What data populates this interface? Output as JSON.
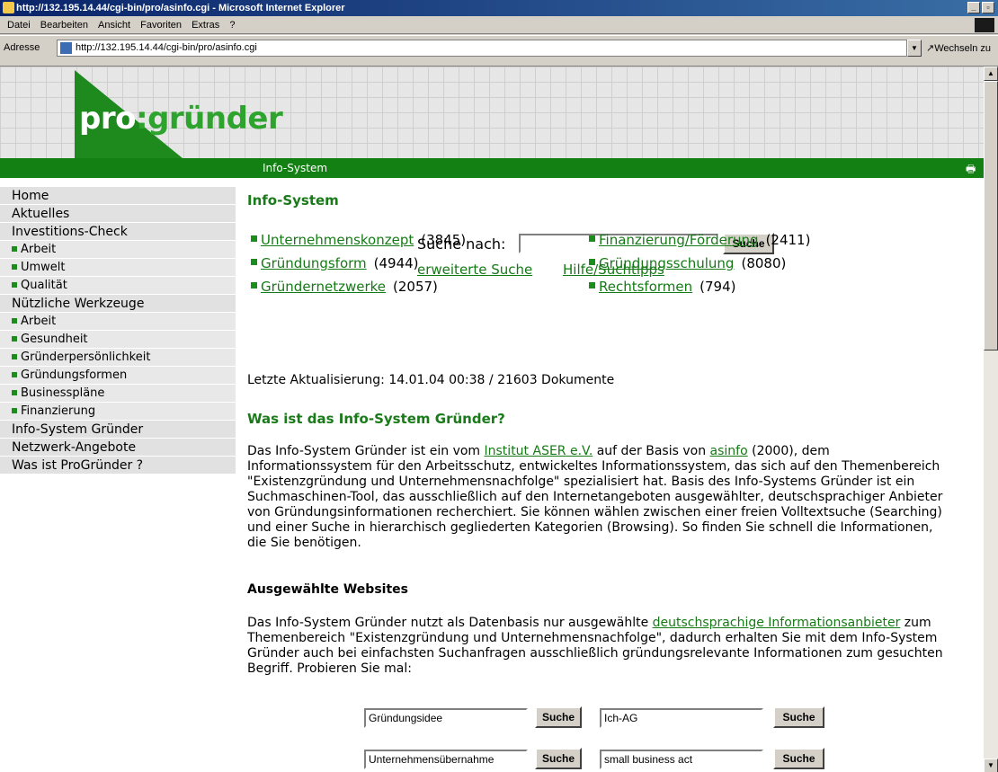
{
  "window": {
    "title": "http://132.195.14.44/cgi-bin/pro/asinfo.cgi - Microsoft Internet Explorer",
    "controls": [
      "_",
      "▫",
      "x"
    ]
  },
  "menu": [
    "Datei",
    "Bearbeiten",
    "Ansicht",
    "Favoriten",
    "Extras",
    "?"
  ],
  "address": {
    "label": "Adresse",
    "url": "http://132.195.14.44/cgi-bin/pro/asinfo.cgi",
    "go": "Wechseln zu"
  },
  "header": {
    "logo_part1": "pro",
    "logo_part2": ":gründer",
    "bar_title": "Info-System"
  },
  "sidebar": [
    {
      "label": "Home",
      "sub": false
    },
    {
      "label": "Aktuelles",
      "sub": false
    },
    {
      "label": "Investitions-Check",
      "sub": false
    },
    {
      "label": "Arbeit",
      "sub": true
    },
    {
      "label": "Umwelt",
      "sub": true
    },
    {
      "label": "Qualität",
      "sub": true
    },
    {
      "label": "Nützliche Werkzeuge",
      "sub": false
    },
    {
      "label": "Arbeit",
      "sub": true
    },
    {
      "label": "Gesundheit",
      "sub": true
    },
    {
      "label": "Gründerpersönlichkeit",
      "sub": true
    },
    {
      "label": "Gründungsformen",
      "sub": true
    },
    {
      "label": "Businesspläne",
      "sub": true
    },
    {
      "label": "Finanzierung",
      "sub": true
    },
    {
      "label": "Info-System Gründer",
      "sub": false
    },
    {
      "label": "Netzwerk-Angebote",
      "sub": false
    },
    {
      "label": "Was ist ProGründer ?",
      "sub": false
    }
  ],
  "main": {
    "title": "Info-System",
    "search_label": "Suche nach:",
    "search_value": "",
    "search_button": "Suche",
    "link_advanced": "erweiterte Suche",
    "link_help": "Hilfe/Suchtipps",
    "categories": [
      {
        "label": "Unternehmenskonzept",
        "count": "(3845)"
      },
      {
        "label": "Finanzierung/Förderung",
        "count": "(2411)"
      },
      {
        "label": "Gründungsform",
        "count": "(4944)"
      },
      {
        "label": "Gründungsschulung",
        "count": "(8080)"
      },
      {
        "label": "Gründernetzwerke",
        "count": "(2057)"
      },
      {
        "label": "Rechtsformen",
        "count": "(794)"
      }
    ],
    "updated": "Letzte Aktualisierung: 14.01.04 00:38 / 21603 Dokumente",
    "heading2": "Was ist das Info-System Gründer?",
    "para1": {
      "pre": "Das Info-System Gründer ist ein vom ",
      "link1": "Institut ASER e.V.",
      "mid": " auf der Basis von ",
      "link2": "asinfo",
      "post": " (2000), dem Informationssystem für den Arbeitsschutz, entwickeltes Informationssystem, das sich auf den Themenbereich \"Existenzgründung und Unternehmensnachfolge\" spezialisiert hat. Basis des Info-Systems Gründer ist ein Suchmaschinen-Tool, das ausschließlich auf den Internetangeboten ausgewählter, deutschsprachiger Anbieter von Gründungsinformationen recherchiert. Sie können wählen zwischen einer freien Volltextsuche (Searching) und einer Suche in hierarchisch gegliederten Kategorien (Browsing). So finden Sie schnell die Informationen, die Sie benötigen."
    },
    "heading3": "Ausgewählte Websites",
    "para2": {
      "pre": "Das Info-System Gründer nutzt als Datenbasis nur ausgewählte ",
      "link": "deutschsprachige Informationsanbieter",
      "post": " zum Themenbereich \"Existenzgründung und Unternehmensnachfolge\", dadurch erhalten Sie mit dem Info-System Gründer auch bei einfachsten Suchanfragen ausschließlich gründungsrelevante Informationen zum gesuchten Begriff. Probieren Sie mal:"
    },
    "examples": [
      {
        "value": "Gründungsidee",
        "button": "Suche"
      },
      {
        "value": "Ich-AG",
        "button": "Suche"
      },
      {
        "value": "Unternehmensübernahme",
        "button": "Suche"
      },
      {
        "value": "small business act",
        "button": "Suche"
      }
    ]
  },
  "colors": {
    "brand_green": "#138013",
    "link_green": "#157a15",
    "title_blue": "#0a246a"
  }
}
